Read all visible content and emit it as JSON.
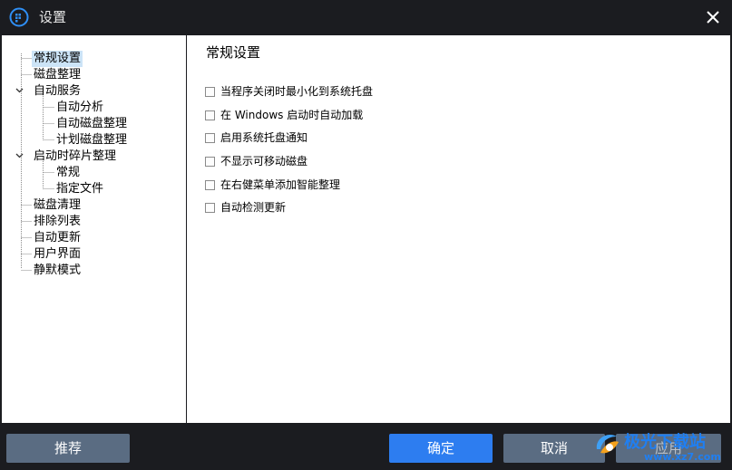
{
  "window": {
    "title": "设置"
  },
  "sidebar": {
    "items": [
      {
        "label": "常规设置"
      },
      {
        "label": "磁盘整理"
      },
      {
        "label": "自动服务"
      },
      {
        "label": "自动分析"
      },
      {
        "label": "自动磁盘整理"
      },
      {
        "label": "计划磁盘整理"
      },
      {
        "label": "启动时碎片整理"
      },
      {
        "label": "常规"
      },
      {
        "label": "指定文件"
      },
      {
        "label": "磁盘清理"
      },
      {
        "label": "排除列表"
      },
      {
        "label": "自动更新"
      },
      {
        "label": "用户界面"
      },
      {
        "label": "静默模式"
      }
    ]
  },
  "main": {
    "title": "常规设置",
    "options": [
      {
        "label": "当程序关闭时最小化到系统托盘",
        "checked": false
      },
      {
        "label": "在 Windows 启动时自动加载",
        "checked": false
      },
      {
        "label": "启用系统托盘通知",
        "checked": false
      },
      {
        "label": "不显示可移动磁盘",
        "checked": false
      },
      {
        "label": "在右健菜单添加智能整理",
        "checked": false
      },
      {
        "label": "自动检测更新",
        "checked": false
      }
    ]
  },
  "footer": {
    "recommend_label": "推荐",
    "ok_label": "确定",
    "cancel_label": "取消",
    "apply_label": "应用"
  },
  "watermark": {
    "text": "极光下载站",
    "url": "www.xz7.com"
  },
  "colors": {
    "background": "#1b1c20",
    "primary_button": "#2d7df0",
    "secondary_button": "#5a6c82",
    "selection": "#cce4f7"
  }
}
